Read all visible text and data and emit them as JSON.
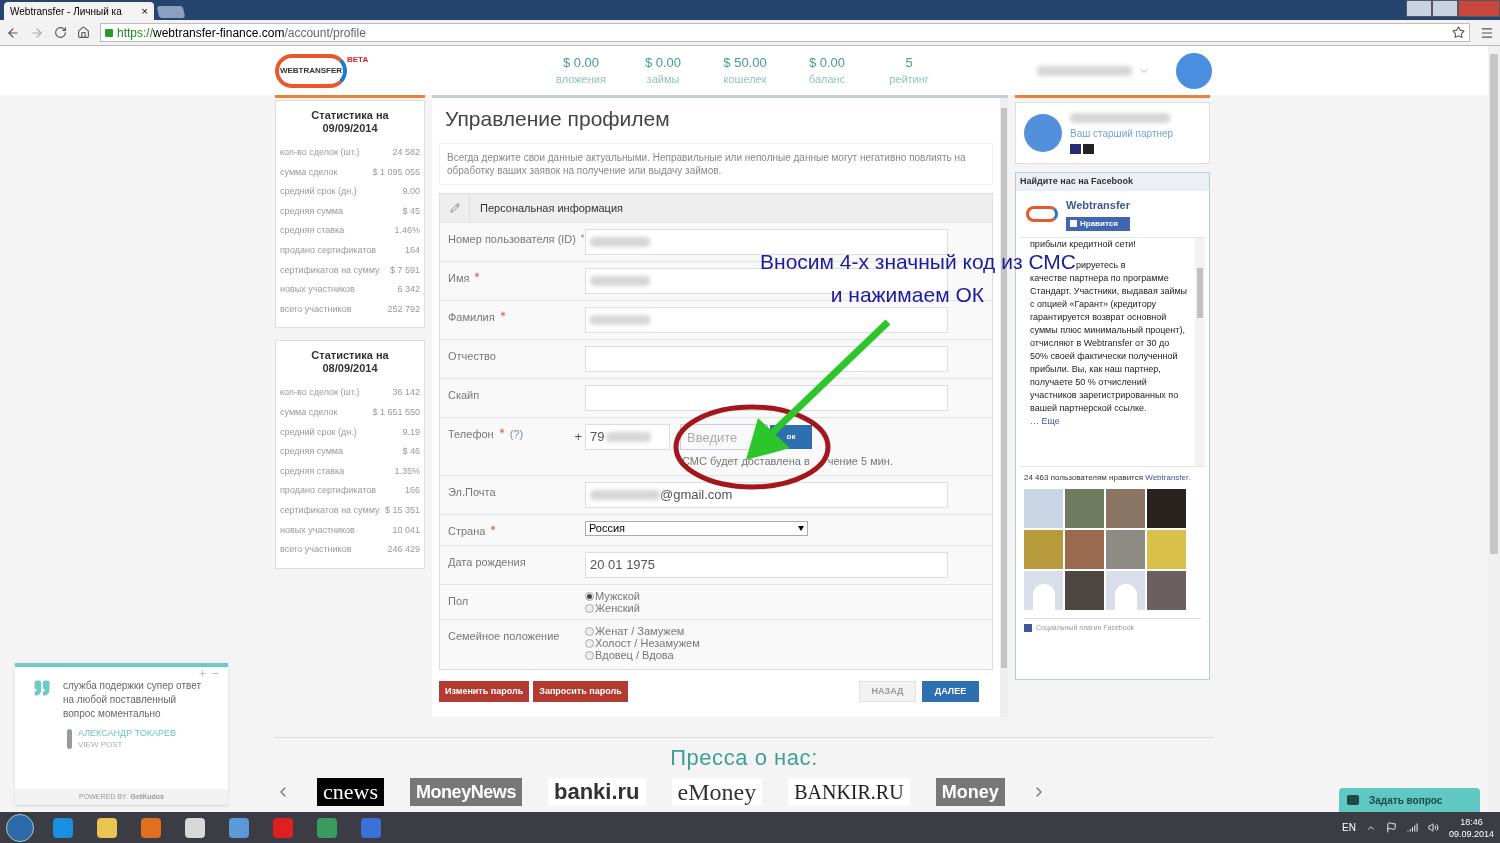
{
  "browser": {
    "tab_title": "Webtransfer - Личный ка",
    "tab_close": "×",
    "url_scheme": "https://",
    "url_host": "webtransfer-finance.com",
    "url_path": "/account/profile"
  },
  "header": {
    "logo_text": "WEBTRANSFER",
    "beta": "BETA",
    "stats": [
      {
        "value": "$ 0.00",
        "label": "вложения"
      },
      {
        "value": "$ 0.00",
        "label": "займы"
      },
      {
        "value": "$ 50.00",
        "label": "кошелек"
      },
      {
        "value": "$ 0.00",
        "label": "баланс"
      },
      {
        "value": "5",
        "label": "рейтинг"
      }
    ]
  },
  "stat_cards": [
    {
      "title": "Статистика на 09/09/2014",
      "rows": [
        [
          "кол-во сделок (шт.)",
          "24 582"
        ],
        [
          "сумма сделок",
          "$ 1 095 055"
        ],
        [
          "средний срок (дн.)",
          "9.00"
        ],
        [
          "средняя сумма",
          "$ 45"
        ],
        [
          "средняя ставка",
          "1.46%"
        ],
        [
          "продано сертификатов",
          "164"
        ],
        [
          "сертификатов на сумму",
          "$ 7 591"
        ],
        [
          "новых участников",
          "6 342"
        ],
        [
          "всего участников",
          "252 792"
        ]
      ]
    },
    {
      "title": "Статистика на 08/09/2014",
      "rows": [
        [
          "кол-во сделок (шт.)",
          "36 142"
        ],
        [
          "сумма сделок",
          "$ 1 651 550"
        ],
        [
          "средний срок (дн.)",
          "9.19"
        ],
        [
          "средняя сумма",
          "$ 46"
        ],
        [
          "средняя ставка",
          "1.35%"
        ],
        [
          "продано сертификатов",
          "166"
        ],
        [
          "сертификатов на сумму",
          "$ 15 351"
        ],
        [
          "новых участников",
          "10 041"
        ],
        [
          "всего участников",
          "246 429"
        ]
      ]
    }
  ],
  "profile": {
    "title": "Управление профилем",
    "notice": "Всегда держите свои данные актуальными. Неправильные или неполные данные могут негативно повлиять на обработку ваших заявок на получение или выдачу займов.",
    "section": "Персональная информация",
    "fields": [
      {
        "kind": "blurred",
        "label": "Номер пользователя (ID)",
        "required": true
      },
      {
        "kind": "blurred",
        "label": "Имя",
        "required": true
      },
      {
        "kind": "blurred",
        "label": "Фамилия",
        "required": true
      },
      {
        "kind": "text",
        "label": "Отчество",
        "required": false
      },
      {
        "kind": "text",
        "label": "Скайп",
        "required": false
      },
      {
        "kind": "phone",
        "label": "Телефон",
        "required": true,
        "help": "(?)",
        "prefix": "+",
        "value": "79",
        "code_placeholder": "Введите",
        "ok": "ок",
        "hint_left": "СМС будет доставлена в",
        "hint_right": "чение 5 мин."
      },
      {
        "kind": "email",
        "label": "Эл.Почта",
        "required": false,
        "value": "@gmail.com"
      },
      {
        "kind": "select",
        "label": "Страна",
        "required": true,
        "value": "Россия"
      },
      {
        "kind": "text",
        "label": "Дата рождения",
        "required": false,
        "value": "20 01 1975"
      },
      {
        "kind": "radio",
        "label": "Пол",
        "required": false,
        "options": [
          {
            "label": "Мужской",
            "selected": true
          },
          {
            "label": "Женский",
            "selected": false
          }
        ]
      },
      {
        "kind": "radio",
        "label": "Семейное положение",
        "required": false,
        "options": [
          {
            "label": "Женат / Замужем",
            "selected": false
          },
          {
            "label": "Холост / Незамужем",
            "selected": false
          },
          {
            "label": "Вдовец / Вдова",
            "selected": false
          }
        ]
      }
    ],
    "buttons": [
      {
        "label": "Изменить пароль",
        "kind": "danger",
        "disabled": false
      },
      {
        "label": "Запросить пароль",
        "kind": "danger",
        "disabled": false
      },
      {
        "label": "НАЗАД",
        "kind": "nav",
        "disabled": true
      },
      {
        "label": "ДАЛЕЕ",
        "kind": "nav",
        "disabled": false
      }
    ]
  },
  "partner": {
    "caption": "Ваш старший партнер"
  },
  "facebook": {
    "heading": "Найдите нас на Facebook",
    "page_name": "Webtransfer",
    "like": "Нравится",
    "feed_first": "прибыли кредитной сети!",
    "feed_cut": "рируетесь в",
    "feed_text": "качестве партнера по программе Стандарт. Участники, выдавая займы с опцией «Гарант» (кредитору гарантируется возврат основной суммы плюс минимальный процент), отчисляют в Webtransfer от 30 до 50% своей фактически полученной прибыли. Вы, как наш партнер, получаете 50 % отчислений участников зарегистрированных по вашей партнерской ссылке.",
    "more": "… Еще",
    "likes_text": "24 463 пользователям нравится",
    "likes_link": "Webtransfer.",
    "fans": [
      {
        "kind": "photo",
        "color": "#c9d6e6"
      },
      {
        "kind": "photo",
        "color": "#6f7b5e"
      },
      {
        "kind": "photo",
        "color": "#8a7564"
      },
      {
        "kind": "photo",
        "color": "#2a221e"
      },
      {
        "kind": "photo",
        "color": "#b79a3c"
      },
      {
        "kind": "photo",
        "color": "#9a6a4e"
      },
      {
        "kind": "photo",
        "color": "#8e8a84"
      },
      {
        "kind": "photo",
        "color": "#d8c04a"
      },
      {
        "kind": "silhouette",
        "color": "#d8dfea"
      },
      {
        "kind": "photo",
        "color": "#4e4640"
      },
      {
        "kind": "silhouette",
        "color": "#d8dfea"
      },
      {
        "kind": "photo",
        "color": "#6a6060"
      }
    ],
    "plugin": "Социальный плагин Facebook"
  },
  "annotation": {
    "line1": "Вносим 4-х значный код из СМС",
    "line2": "и нажимаем ОК"
  },
  "press": {
    "title": "Пресса о нас:",
    "logos": [
      "cnews",
      "MoneyNews",
      "banki.ru",
      "eMoney",
      "BANKIR.RU",
      "Money"
    ]
  },
  "testimonial": {
    "text": "служба подержки супер ответ на любой поставленный вопрос моментально",
    "author": "АЛЕКСАНДР ТОКАРЕВ",
    "view": "VIEW POST",
    "powered": "POWERED BY",
    "brand": "GetKudos"
  },
  "ask_button": "Задать вопрос",
  "taskbar": {
    "lang": "EN",
    "time": "18:46",
    "date": "09.09.2014"
  }
}
